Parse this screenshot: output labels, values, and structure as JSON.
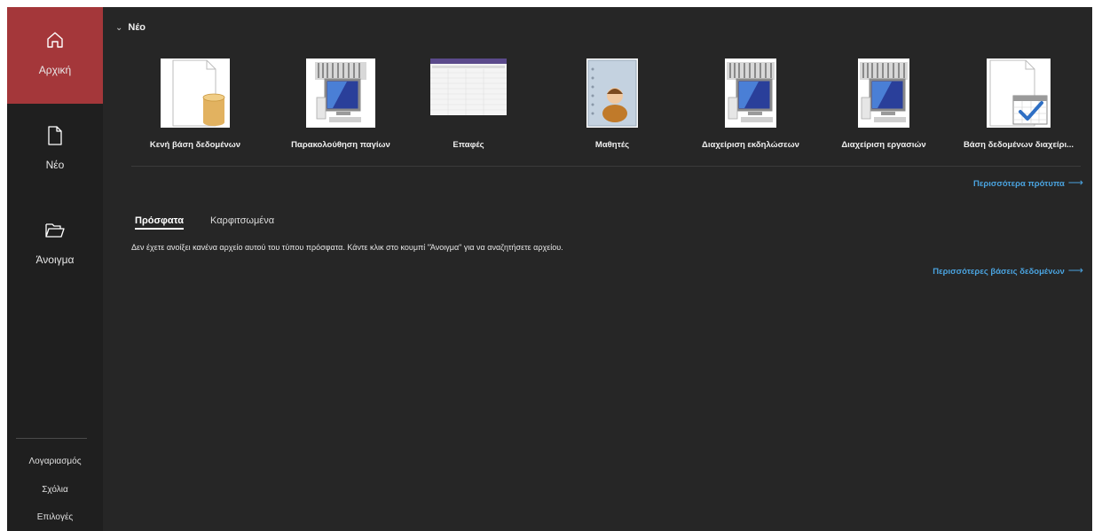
{
  "sidebar": {
    "home_label": "Αρχική",
    "new_label": "Νέο",
    "open_label": "Άνοιγμα",
    "account_label": "Λογαριασμός",
    "feedback_label": "Σχόλια",
    "options_label": "Επιλογές"
  },
  "main": {
    "new_section_title": "Νέο",
    "templates": [
      {
        "label": "Κενή βάση δεδομένων",
        "icon": "blank-database-icon"
      },
      {
        "label": "Παρακολούθηση παγίων",
        "icon": "computer-icon"
      },
      {
        "label": "Επαφές",
        "icon": "spreadsheet-preview-icon"
      },
      {
        "label": "Μαθητές",
        "icon": "address-book-icon"
      },
      {
        "label": "Διαχείριση εκδηλώσεων",
        "icon": "computer-icon"
      },
      {
        "label": "Διαχείριση εργασιών",
        "icon": "computer-icon"
      },
      {
        "label": "Βάση δεδομένων διαχείρι...",
        "icon": "calendar-check-icon"
      }
    ],
    "more_templates_link": "Περισσότερα πρότυπα",
    "tabs": [
      {
        "label": "Πρόσφατα",
        "active": true
      },
      {
        "label": "Καρφιτσωμένα",
        "active": false
      }
    ],
    "empty_message": "Δεν έχετε ανοίξει κανένα αρχείο αυτού του τύπου πρόσφατα. Κάντε κλικ στο κουμπί \"Άνοιγμα\" για να αναζητήσετε αρχείου.",
    "more_databases_link": "Περισσότερες βάσεις δεδομένων"
  },
  "colors": {
    "accent_active": "#a4373a",
    "link": "#4aa3df",
    "background": "#262626",
    "sidebar": "#1f1f1f"
  }
}
